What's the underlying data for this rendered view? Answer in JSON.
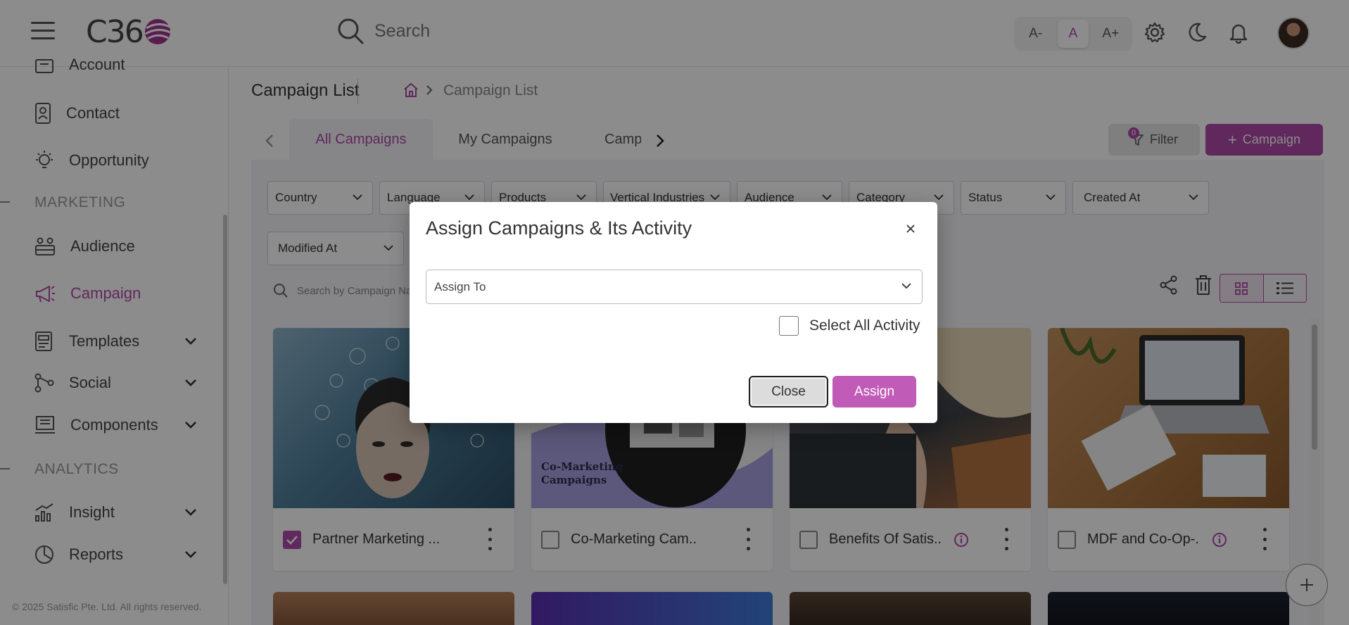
{
  "header": {
    "logo_text": "C36",
    "search_placeholder": "Search",
    "font_small": "A-",
    "font_normal": "A",
    "font_large": "A+"
  },
  "sidebar": {
    "items": [
      {
        "label": "Account",
        "icon": "account-icon"
      },
      {
        "label": "Contact",
        "icon": "contact-icon"
      },
      {
        "label": "Opportunity",
        "icon": "lightbulb-icon"
      },
      {
        "label": "Audience",
        "icon": "audience-icon"
      },
      {
        "label": "Campaign",
        "icon": "megaphone-icon",
        "active": true
      },
      {
        "label": "Templates",
        "icon": "templates-icon"
      },
      {
        "label": "Social",
        "icon": "social-icon"
      },
      {
        "label": "Components",
        "icon": "components-icon"
      },
      {
        "label": "Insight",
        "icon": "insight-icon"
      },
      {
        "label": "Reports",
        "icon": "reports-icon"
      }
    ],
    "section_marketing": "MARKETING",
    "section_analytics": "ANALYTICS",
    "copyright": "© 2025 Satisfic Pte. Ltd. All rights reserved."
  },
  "main": {
    "title": "Campaign List",
    "breadcrumb_current": "Campaign List",
    "tabs": [
      "All Campaigns",
      "My Campaigns",
      "Camp"
    ],
    "filter_label": "Filter",
    "filter_count": "0",
    "add_label": "Campaign",
    "filters": [
      "Country",
      "Language",
      "Products",
      "Vertical Industries",
      "Audience",
      "Category",
      "Status",
      "Created At",
      "Modified At"
    ],
    "list_search_placeholder": "Search by Campaign Na",
    "cards": [
      {
        "title": "Partner Marketing ...",
        "checked": true,
        "info": false
      },
      {
        "title": "Co-Marketing Cam...",
        "checked": false,
        "info": false,
        "image_text_1": "Co-Marketing",
        "image_text_2": "Campaigns"
      },
      {
        "title": "Benefits Of Satis...",
        "checked": false,
        "info": true
      },
      {
        "title": "MDF and Co-Op-...",
        "checked": false,
        "info": true
      }
    ]
  },
  "modal": {
    "title": "Assign Campaigns & Its Activity",
    "assign_to_placeholder": "Assign To",
    "select_all_label": "Select All Activity",
    "close_label": "Close",
    "assign_label": "Assign"
  },
  "colors": {
    "accent": "#b04aa8",
    "overlay": "rgba(0,0,0,0.45)"
  }
}
